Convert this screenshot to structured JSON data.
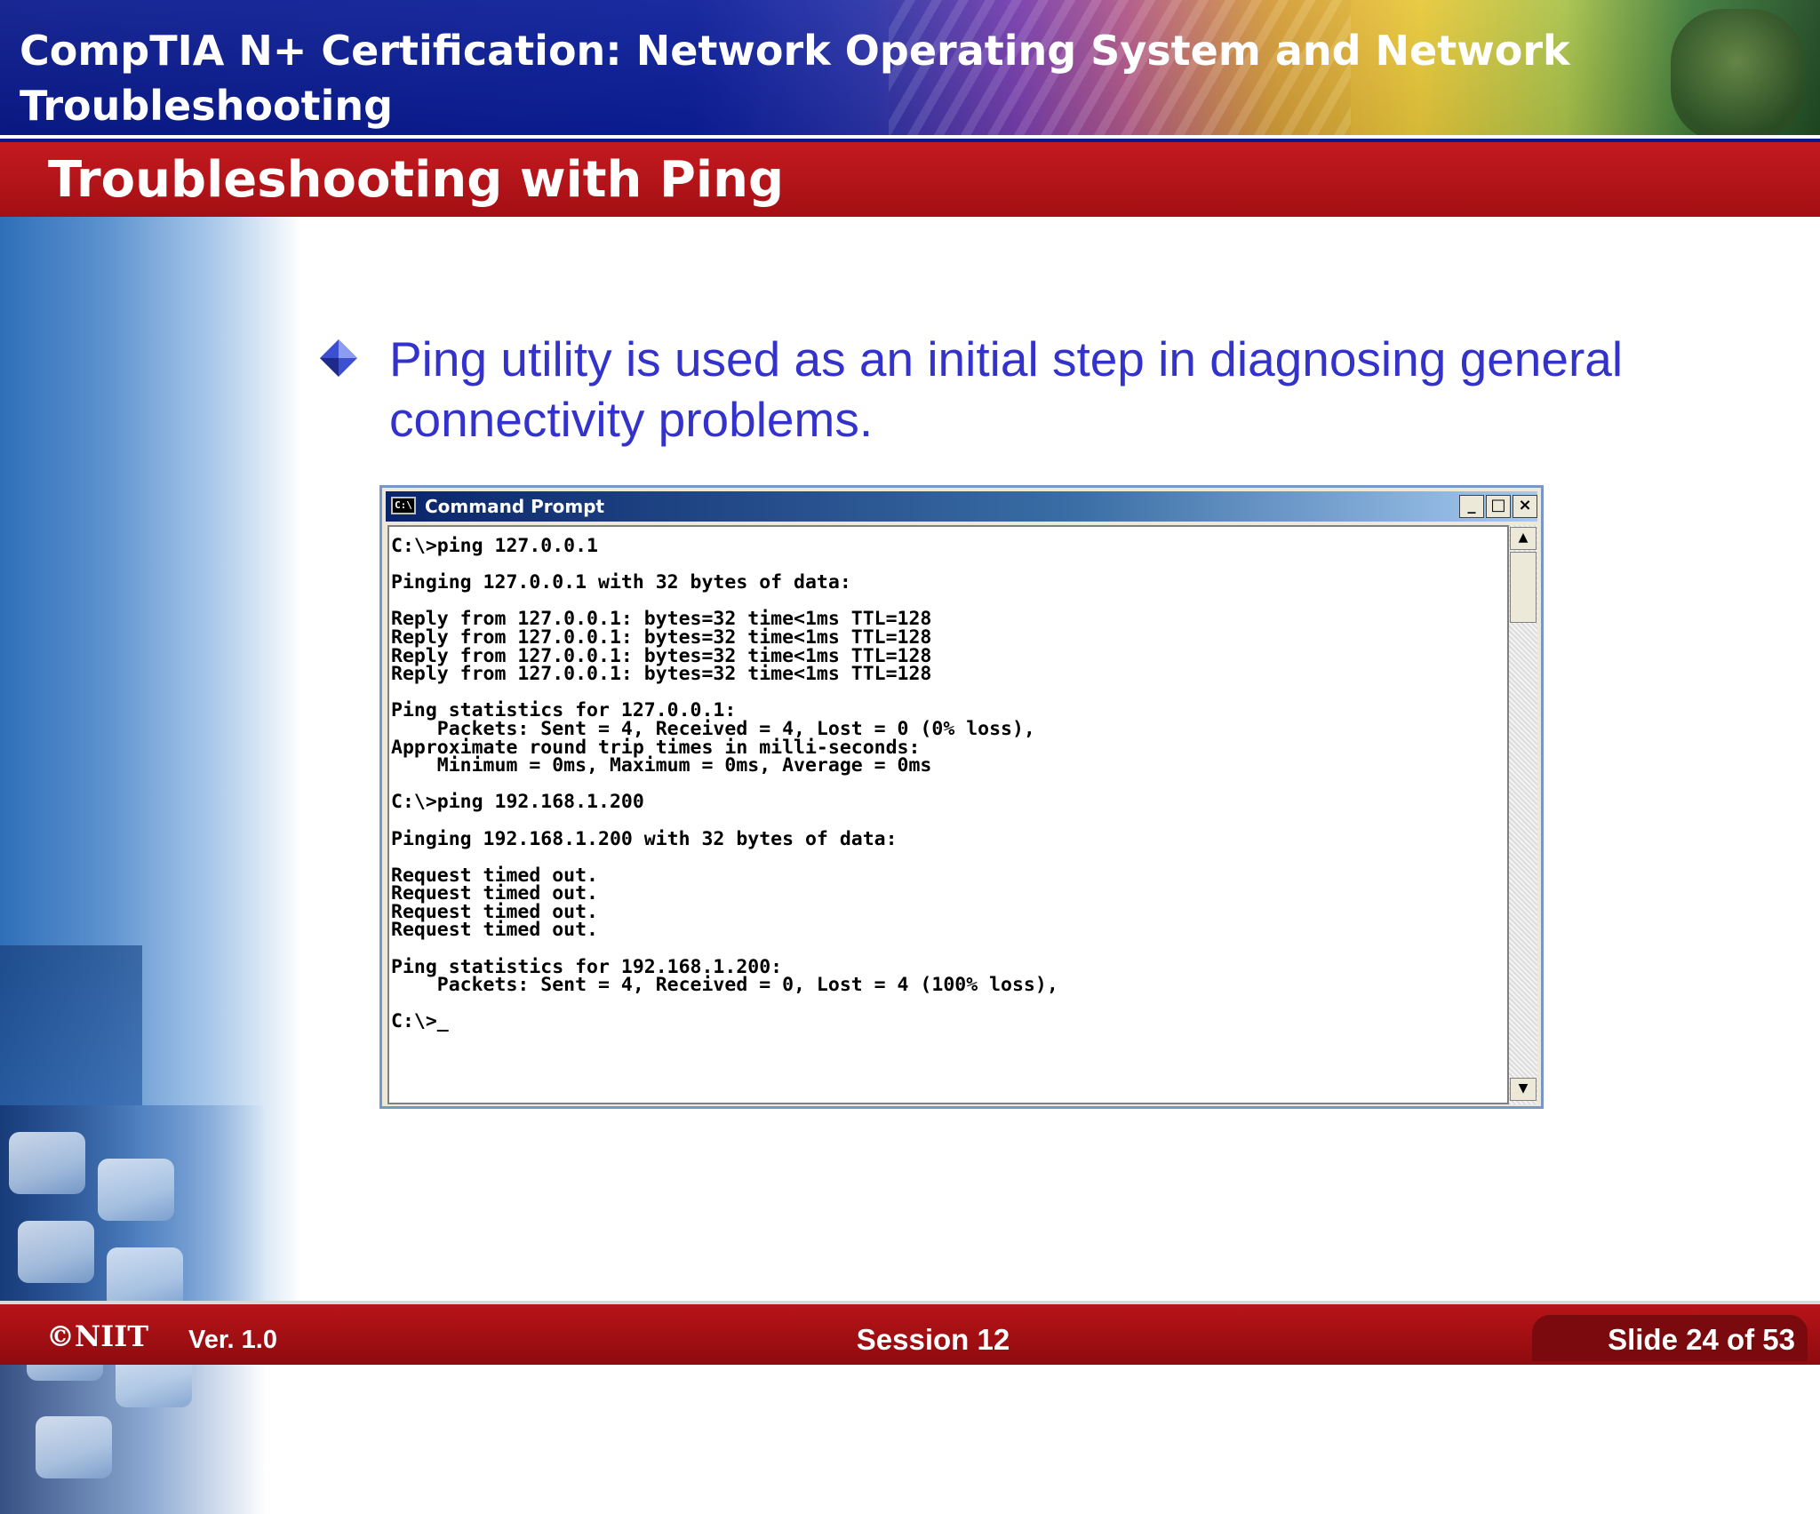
{
  "header": {
    "title": "CompTIA N+ Certification:  Network  Operating System and Network\nTroubleshooting"
  },
  "slide": {
    "title": "Troubleshooting with Ping",
    "bullet": "Ping utility is used as an initial step in diagnosing general connectivity problems."
  },
  "command_window": {
    "title": "Command Prompt",
    "icon_label": "C:\\",
    "buttons": {
      "minimize": "_",
      "maximize": "□",
      "close": "×"
    },
    "output": "C:\\>ping 127.0.0.1\n\nPinging 127.0.0.1 with 32 bytes of data:\n\nReply from 127.0.0.1: bytes=32 time<1ms TTL=128\nReply from 127.0.0.1: bytes=32 time<1ms TTL=128\nReply from 127.0.0.1: bytes=32 time<1ms TTL=128\nReply from 127.0.0.1: bytes=32 time<1ms TTL=128\n\nPing statistics for 127.0.0.1:\n    Packets: Sent = 4, Received = 4, Lost = 0 (0% loss),\nApproximate round trip times in milli-seconds:\n    Minimum = 0ms, Maximum = 0ms, Average = 0ms\n\nC:\\>ping 192.168.1.200\n\nPinging 192.168.1.200 with 32 bytes of data:\n\nRequest timed out.\nRequest timed out.\nRequest timed out.\nRequest timed out.\n\nPing statistics for 192.168.1.200:\n    Packets: Sent = 4, Received = 0, Lost = 4 (100% loss),\n\nC:\\>_"
  },
  "footer": {
    "logo": "©NIIT",
    "version": "Ver.  1.0",
    "session": "Session 12",
    "slide_number": "Slide 24 of 53"
  },
  "colors": {
    "header_blue": "#0a1a8c",
    "title_red": "#b81418",
    "bullet_text": "#3333cc"
  }
}
